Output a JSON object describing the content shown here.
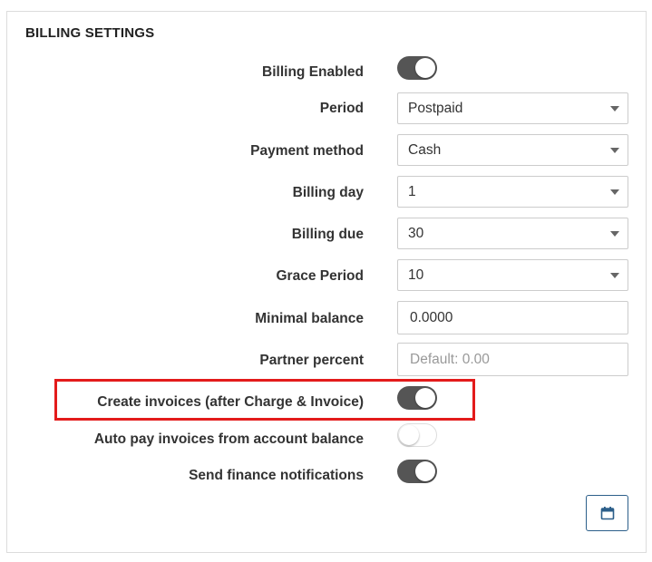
{
  "panel": {
    "title": "BILLING SETTINGS"
  },
  "fields": {
    "billing_enabled": {
      "label": "Billing Enabled",
      "checked": true
    },
    "period": {
      "label": "Period",
      "value": "Postpaid"
    },
    "payment_method": {
      "label": "Payment method",
      "value": "Cash"
    },
    "billing_day": {
      "label": "Billing day",
      "value": "1"
    },
    "billing_due": {
      "label": "Billing due",
      "value": "30"
    },
    "grace_period": {
      "label": "Grace Period",
      "value": "10"
    },
    "minimal_balance": {
      "label": "Minimal balance",
      "value": "0.0000"
    },
    "partner_percent": {
      "label": "Partner percent",
      "value": "",
      "placeholder": "Default: 0.00"
    },
    "create_invoices": {
      "label": "Create invoices (after Charge & Invoice)",
      "checked": true
    },
    "auto_pay": {
      "label": "Auto pay invoices from account balance",
      "checked": false
    },
    "send_notifications": {
      "label": "Send finance notifications",
      "checked": true
    }
  },
  "colors": {
    "highlight": "#e31b1b",
    "toggle_on": "#555555",
    "button_border": "#2c5f8a"
  },
  "icons": {
    "save_button_icon": "calendar-icon"
  }
}
